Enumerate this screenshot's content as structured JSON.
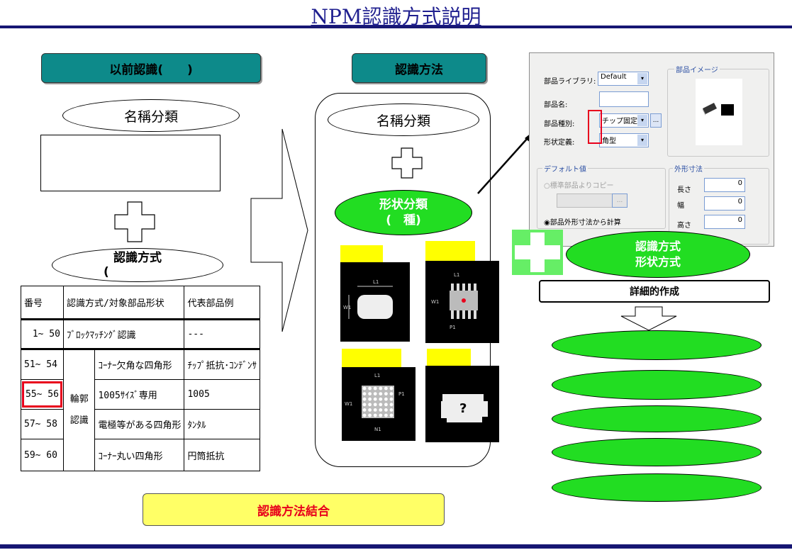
{
  "title": "NPM認識方式説明",
  "left": {
    "header": "以前認識(　　)",
    "name_ellipse": "名稱分類",
    "method_ellipse_line1": "認識方式",
    "method_ellipse_line2": "("
  },
  "table": {
    "headers": [
      "番号",
      "認識方式/対象部品形状",
      "代表部品例"
    ],
    "row1": {
      "num": "1~ 50",
      "method": "ﾌﾞﾛｯｸﾏｯﾁﾝｸﾞ認識",
      "example": "---"
    },
    "group_label_1": "輪郭",
    "group_label_2": "認識",
    "rows": [
      {
        "num": "51~ 54",
        "method": "ｺｰﾅｰ欠角な四角形",
        "example": "ﾁｯﾌﾟ抵抗･ｺﾝﾃﾞﾝｻ"
      },
      {
        "num": "55~ 56",
        "method": "1005ｻｲｽﾞ専用",
        "example": "1005"
      },
      {
        "num": "57~ 58",
        "method": "電極等がある四角形",
        "example": "ﾀﾝﾀﾙ"
      },
      {
        "num": "59~ 60",
        "method": "ｺｰﾅｰ丸い四角形",
        "example": "円筒抵抗"
      }
    ]
  },
  "bottom_button": "認識方法結合",
  "center": {
    "header": "認識方法",
    "name_ellipse": "名稱分類",
    "shape_ellipse_line1": "形状分類",
    "shape_ellipse_line2": "(　種)",
    "thumb_labels": [
      "L1",
      "W1",
      "L1",
      "W1",
      "P1",
      "L1",
      "W1",
      "N1",
      "P1",
      "?"
    ]
  },
  "dialog": {
    "lib_label": "部品ライブラリ:",
    "lib_value": "Default",
    "name_label": "部品名:",
    "kind_label": "部品種別:",
    "kind_value": "チップ固定抵",
    "kind_btn": "...",
    "shape_label": "形状定義:",
    "shape_value": "角型",
    "image_group": "部品イメージ",
    "default_group": "デフォルト値",
    "radio1": "標準部品よりコピー",
    "radio2": "部品外形寸法から計算",
    "dots_btn": "...",
    "dim_group": "外形寸法",
    "dims": [
      {
        "label": "長さ",
        "value": "0"
      },
      {
        "label": "幅",
        "value": "0"
      },
      {
        "label": "高さ",
        "value": "0"
      }
    ]
  },
  "right": {
    "green_line1": "認識方式",
    "green_line2": "形状方式",
    "detail": "詳細的作成"
  },
  "colors": {
    "teal": "#0d8a8a",
    "green": "#22dd22",
    "yellow": "#ffff66",
    "navy": "#161673",
    "red": "#e8001c"
  }
}
